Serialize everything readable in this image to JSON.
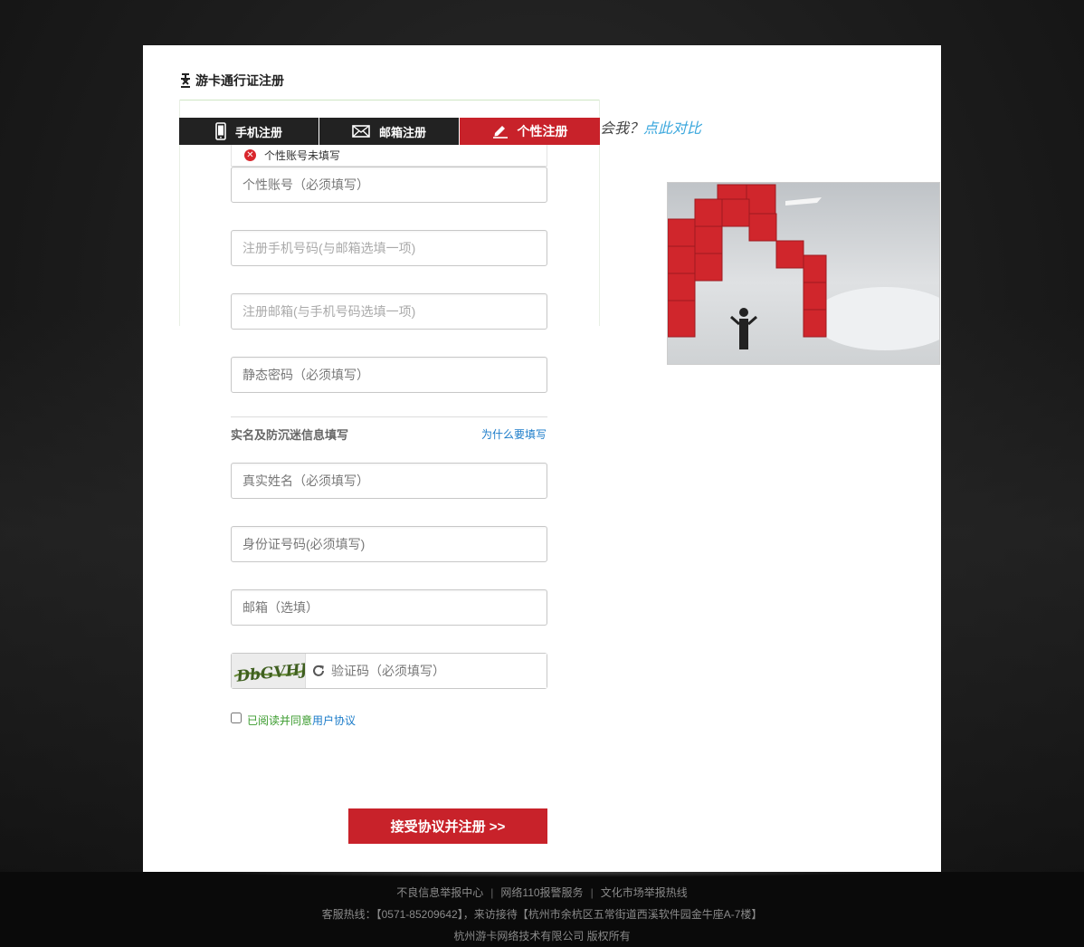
{
  "header": {
    "title": "游卡通行证注册"
  },
  "tabs": [
    {
      "label": "手机注册",
      "icon": "phone-icon"
    },
    {
      "label": "邮箱注册",
      "icon": "mail-icon"
    },
    {
      "label": "个性注册",
      "icon": "edit-icon",
      "active": true
    }
  ],
  "error": {
    "message": "个性账号未填写"
  },
  "fields": {
    "account": {
      "placeholder": "个性账号（必须填写）"
    },
    "mobile": {
      "placeholder": "注册手机号码(与邮箱选填一项)"
    },
    "email_reg": {
      "placeholder": "注册邮箱(与手机号码选填一项)"
    },
    "password": {
      "placeholder": "静态密码（必须填写）"
    },
    "realname": {
      "placeholder": "真实姓名（必须填写）"
    },
    "idcard": {
      "placeholder": "身份证号码(必须填写)"
    },
    "email_opt": {
      "placeholder": "邮箱（选填）"
    },
    "captcha": {
      "placeholder": "验证码（必须填写）",
      "image_text": "DbGVHJ"
    }
  },
  "section": {
    "title": "实名及防沉迷信息填写",
    "why_link": "为什么要填写"
  },
  "agreement": {
    "read_text": "已阅读并同意",
    "link_text": "用户协议"
  },
  "submit": {
    "label": "接受协议并注册 >>"
  },
  "compare": {
    "prefix": "会我？",
    "link": "点此对比"
  },
  "colors": {
    "accent": "#c8222a",
    "link": "#1a7bc9",
    "agree_green": "#3a9b2d"
  },
  "footer": {
    "links": [
      "不良信息举报中心",
      "网络110报警服务",
      "文化市场举报热线"
    ],
    "contact": "客服热线：【0571-85209642】，来访接待【杭州市余杭区五常街道西溪软件园金牛座A-7楼】",
    "copyright": "杭州游卡网络技术有限公司 版权所有"
  }
}
